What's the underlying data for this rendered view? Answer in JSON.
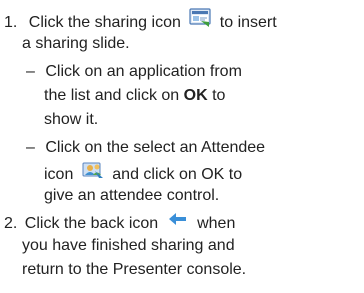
{
  "step1": {
    "number": "1.",
    "line1_before": "Click the sharing icon",
    "line1_after": "to insert",
    "line2": "a sharing slide.",
    "sub1": {
      "dash": "–",
      "line1": "Click on an application from",
      "line2_before": "the list and click on",
      "line2_bold": "OK",
      "line2_after": "to",
      "line3": "show it."
    },
    "sub2": {
      "dash": "–",
      "line1": "Click on the select an Attendee",
      "line2_before": "icon",
      "line2_after": "and click on OK to",
      "line3": "give an attendee control."
    }
  },
  "step2": {
    "number": "2.",
    "line1_before": "Click the back icon",
    "line1_after": "when",
    "line2": "you have finished sharing and",
    "line3": "return to the Presenter console."
  },
  "icons": {
    "sharing": "sharing-icon",
    "attendee": "select-attendee-icon",
    "back": "back-arrow-icon"
  },
  "colors": {
    "text": "#222222",
    "back_arrow": "#3a8fd8"
  }
}
